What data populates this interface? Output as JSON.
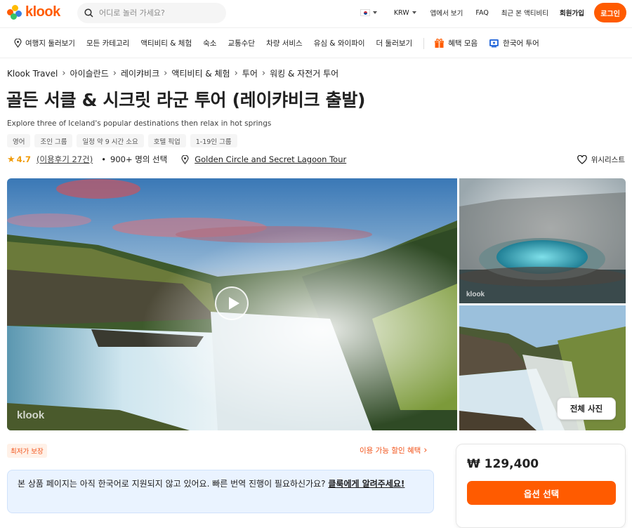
{
  "header": {
    "logo_text": "klook",
    "search_placeholder": "어디로 놀러 가세요?",
    "currency": "KRW",
    "links": [
      "앱에서 보기",
      "FAQ",
      "최근 본 액티비티",
      "회원가입"
    ],
    "login_label": "로그인",
    "accent_color": "#ff5b00"
  },
  "categories": {
    "items": [
      "여행지 둘러보기",
      "모든 카테고리",
      "액티비티 & 체험",
      "숙소",
      "교통수단",
      "차량 서비스",
      "유심 & 와이파이",
      "더 둘러보기"
    ],
    "deals_label": "혜택 모음",
    "korean_tour_label": "한국어 투어"
  },
  "breadcrumb": [
    "Klook Travel",
    "아이슬란드",
    "레이캬비크",
    "액티비티 & 체험",
    "투어",
    "워킹 & 자전거 투어"
  ],
  "product": {
    "title": "골든 서클 & 시크릿 라군 투어 (레이캬비크 출발)",
    "subtitle": "Explore three of Iceland's popular destinations then relax in hot springs",
    "tags": [
      "영어",
      "조인 그룹",
      "일정 약 9 시간 소요",
      "호텔 픽업",
      "1-19인 그룹"
    ],
    "rating": "4.7",
    "reviews": "(이용후기 27건)",
    "booked": "900+ 명의 선택",
    "location": "Golden Circle and Secret Lagoon Tour",
    "wishlist_label": "위시리스트"
  },
  "gallery": {
    "watermark": "klook",
    "all_photos_label": "전체 사진"
  },
  "promo": {
    "best_price_badge": "최저가 보장",
    "discount_link": "이용 가능 할인 혜택"
  },
  "notice": {
    "text": "본 상품 페이지는 아직 한국어로 지원되지 않고 있어요. 빠른 번역 진행이 필요하신가요? ",
    "link": "클룩에게 알려주세요!"
  },
  "booking": {
    "price": "₩ 129,400",
    "select_label": "옵션 선택"
  }
}
